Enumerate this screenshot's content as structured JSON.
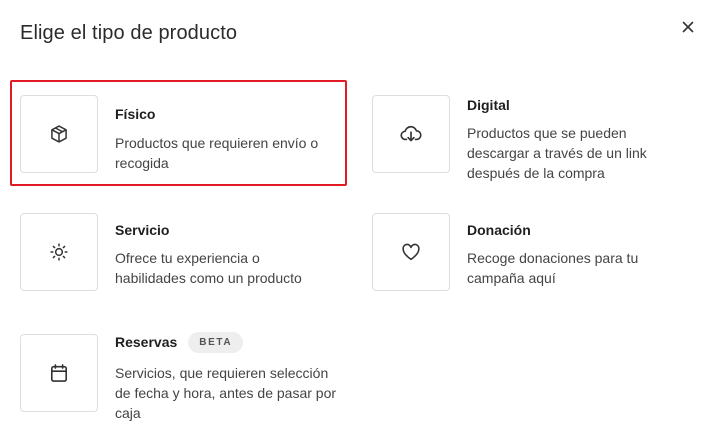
{
  "dialog": {
    "title": "Elige el tipo de producto",
    "close_icon": "close-icon"
  },
  "options": [
    {
      "id": "fisico",
      "icon": "box-icon",
      "title": "Físico",
      "description": "Productos que requieren envío o recogida",
      "selected": true
    },
    {
      "id": "digital",
      "icon": "cloud-download-icon",
      "title": "Digital",
      "description": "Productos que se pueden descargar a través de un link después de la compra",
      "selected": false
    },
    {
      "id": "servicio",
      "icon": "sun-icon",
      "title": "Servicio",
      "description": "Ofrece tu experiencia o habilidades como un producto",
      "selected": false
    },
    {
      "id": "donacion",
      "icon": "heart-icon",
      "title": "Donación",
      "description": "Recoge donaciones para tu campaña aquí",
      "selected": false
    },
    {
      "id": "reservas",
      "icon": "calendar-icon",
      "title": "Reservas",
      "badge": "BETA",
      "description": "Servicios, que requieren selección de fecha y hora, antes de pasar por caja",
      "selected": false
    }
  ],
  "colors": {
    "selection_outline": "#e01b24",
    "border": "#dedede",
    "badge_bg": "#eeeeee"
  }
}
